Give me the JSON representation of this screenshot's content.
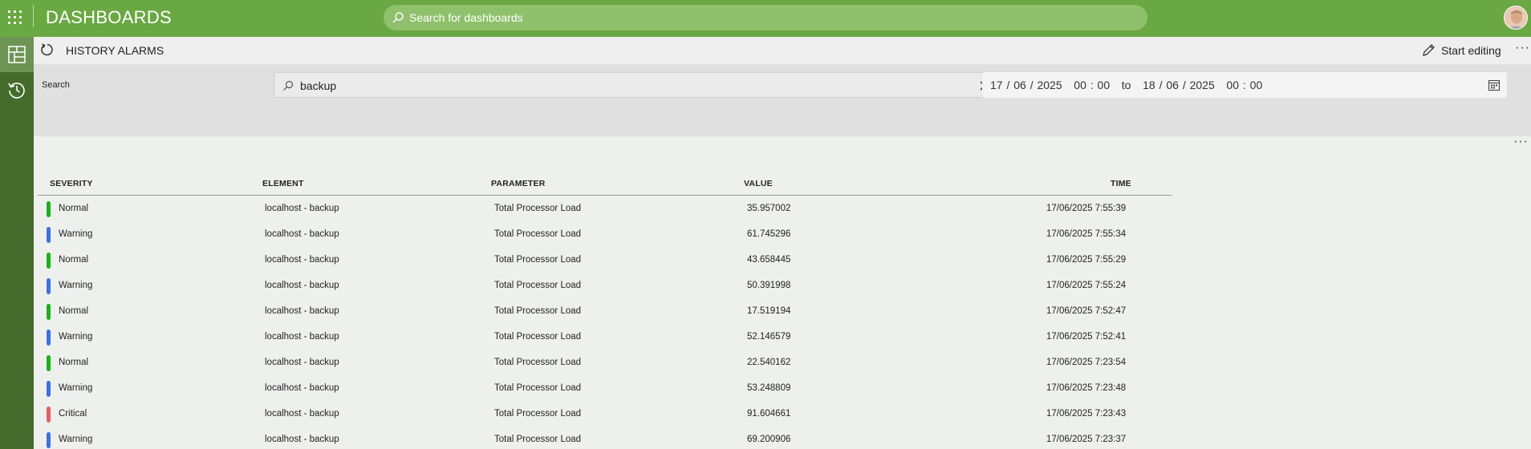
{
  "topbar": {
    "title": "DASHBOARDS",
    "search_placeholder": "Search for dashboards"
  },
  "page": {
    "title": "HISTORY ALARMS",
    "start_editing": "Start editing",
    "more": "···"
  },
  "filters": {
    "search_label": "Search",
    "search_value": "backup",
    "date_range": "17 / 06 / 2025   00 : 00   to   18 / 06 / 2025   00 : 00"
  },
  "table": {
    "more": "···",
    "columns": {
      "severity": "SEVERITY",
      "element": "ELEMENT",
      "parameter": "PARAMETER",
      "value": "VALUE",
      "time": "TIME"
    },
    "rows": [
      {
        "severity": "Normal",
        "element": "localhost - backup",
        "parameter": "Total Processor Load",
        "value": "35.957002",
        "time": "17/06/2025 7:55:39"
      },
      {
        "severity": "Warning",
        "element": "localhost - backup",
        "parameter": "Total Processor Load",
        "value": "61.745296",
        "time": "17/06/2025 7:55:34"
      },
      {
        "severity": "Normal",
        "element": "localhost - backup",
        "parameter": "Total Processor Load",
        "value": "43.658445",
        "time": "17/06/2025 7:55:29"
      },
      {
        "severity": "Warning",
        "element": "localhost - backup",
        "parameter": "Total Processor Load",
        "value": "50.391998",
        "time": "17/06/2025 7:55:24"
      },
      {
        "severity": "Normal",
        "element": "localhost - backup",
        "parameter": "Total Processor Load",
        "value": "17.519194",
        "time": "17/06/2025 7:52:47"
      },
      {
        "severity": "Warning",
        "element": "localhost - backup",
        "parameter": "Total Processor Load",
        "value": "52.146579",
        "time": "17/06/2025 7:52:41"
      },
      {
        "severity": "Normal",
        "element": "localhost - backup",
        "parameter": "Total Processor Load",
        "value": "22.540162",
        "time": "17/06/2025 7:23:54"
      },
      {
        "severity": "Warning",
        "element": "localhost - backup",
        "parameter": "Total Processor Load",
        "value": "53.248809",
        "time": "17/06/2025 7:23:48"
      },
      {
        "severity": "Critical",
        "element": "localhost - backup",
        "parameter": "Total Processor Load",
        "value": "91.604661",
        "time": "17/06/2025 7:23:43"
      },
      {
        "severity": "Warning",
        "element": "localhost - backup",
        "parameter": "Total Processor Load",
        "value": "69.200906",
        "time": "17/06/2025 7:23:37"
      }
    ]
  },
  "colors": {
    "topbar": "#6aa843",
    "leftrail": "#456b2c",
    "severity": {
      "Normal": "#19b219",
      "Warning": "#3c6fe8",
      "Critical": "#ea5a66"
    }
  },
  "icons": {
    "apps": "apps-grid-icon",
    "search": "search-icon",
    "avatar": "user-avatar",
    "dashboards": "dashboards-icon",
    "history": "history-icon",
    "refresh": "refresh-icon",
    "edit": "pencil-icon",
    "clear": "close-icon",
    "calendar": "calendar-icon"
  }
}
